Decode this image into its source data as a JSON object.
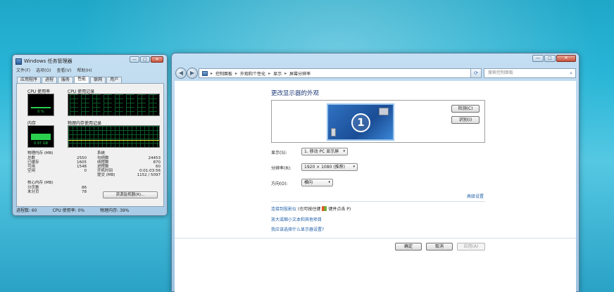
{
  "task_manager": {
    "title": "Windows 任务管理器",
    "window_buttons": {
      "minimize": "—",
      "maximize": "□",
      "close": "✕"
    },
    "menu": [
      "文件(F)",
      "选项(O)",
      "查看(V)",
      "帮助(H)"
    ],
    "tabs": [
      "应用程序",
      "进程",
      "服务",
      "性能",
      "联网",
      "用户"
    ],
    "active_tab": "性能",
    "cpu_usage_label": "CPU 使用率",
    "cpu_usage_value": "0 %",
    "cpu_history_label": "CPU 使用记录",
    "memory_label": "内存",
    "memory_value": "0.97 GB",
    "mem_history_label": "物理内存使用记录",
    "physical_memory": {
      "header": "物理内存 (MB)",
      "rows": [
        [
          "总数",
          "2550"
        ],
        [
          "已缓存",
          "1605"
        ],
        [
          "可用",
          "1548"
        ],
        [
          "空闲",
          "0"
        ]
      ]
    },
    "kernel_memory": {
      "header": "核心内存 (MB)",
      "rows": [
        [
          "分页数",
          "86"
        ],
        [
          "未分页",
          "78"
        ]
      ]
    },
    "system": {
      "header": "系统",
      "rows": [
        [
          "句柄数",
          "24453"
        ],
        [
          "线程数",
          "870"
        ],
        [
          "进程数",
          "60"
        ],
        [
          "开机时间",
          "0:01:03:56"
        ],
        [
          "提交 (MB)",
          "1152 / 5097"
        ]
      ]
    },
    "resource_monitor_button": "资源监视器(R)...",
    "status": {
      "processes": "进程数: 60",
      "cpu": "CPU 使用率: 0%",
      "memory": "物理内存: 39%"
    }
  },
  "control_panel": {
    "window_buttons": {
      "minimize": "—",
      "maximize": "□",
      "close": "✕"
    },
    "back": "◀",
    "forward": "▶",
    "breadcrumb": [
      "控制面板",
      "外观和个性化",
      "显示",
      "屏幕分辨率"
    ],
    "search_placeholder": "搜索控制面板",
    "title": "更改显示器的外观",
    "monitor_number": "1",
    "detect_button": "检测(C)",
    "identify_button": "识别(I)",
    "display_label": "显示(S):",
    "display_value": "1. 移动 PC 显示屏",
    "resolution_label": "分辨率(R):",
    "resolution_value": "1920 × 1080 (推荐)",
    "orientation_label": "方向(O):",
    "orientation_value": "横向",
    "advanced_link": "高级设置",
    "link_projector": "连接到投影仪",
    "link_projector_hint": "(也可按住键",
    "link_projector_hint2": "键并点击 P)",
    "link_text_size": "放大或缩小文本和其他项目",
    "link_which_settings": "我应该选择什么显示器设置?",
    "ok_button": "确定",
    "cancel_button": "取消",
    "apply_button": "应用(A)"
  },
  "colors": {
    "desktop": "#28b5d6",
    "link": "#1f5fa8",
    "heading": "#1e3a78",
    "meter_green": "#2bd14e"
  }
}
